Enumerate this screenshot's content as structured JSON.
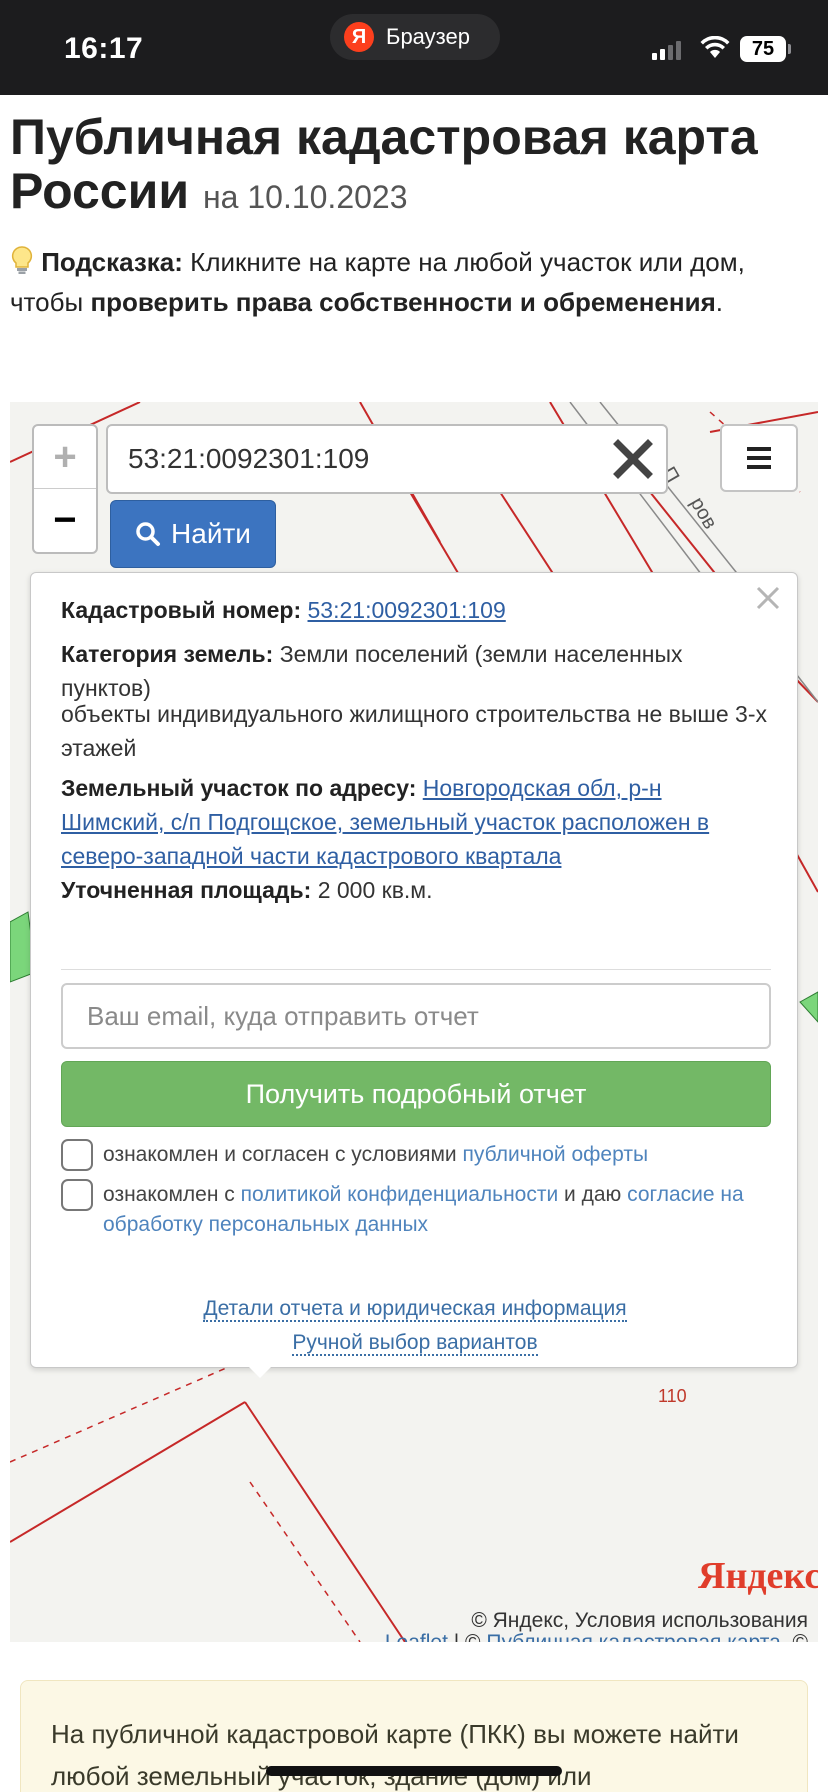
{
  "status_bar": {
    "time": "16:17",
    "browser": "Браузер",
    "browser_logo": "Я",
    "battery": "75"
  },
  "header": {
    "title": "Публичная кадастровая карта России",
    "date": "на 10.10.2023"
  },
  "hint": {
    "icon": "lightbulb-icon",
    "label": "Подсказка:",
    "text1": "Кликните на карте на любой участок или дом, чтобы",
    "bold": "проверить права собственности и обременения",
    "text2": "."
  },
  "map": {
    "zoom_in": "+",
    "zoom_out": "−",
    "search_value": "53:21:0092301:109",
    "find_label": "Найти",
    "street_fragment": "л. П",
    "street_fragment2": "ров",
    "parcel_label": "110",
    "brand": "Яндекс",
    "attribution_line1": "© Яндекс, Условия использования",
    "attribution_leaflet": "Leaflet",
    "attribution_sep": " | © ",
    "attribution_pkk": "Публичная кадастровая карта",
    "attribution_tail": ", ©"
  },
  "popup": {
    "cad_label": "Кадастровый номер:",
    "cad_value": "53:21:0092301:109",
    "cat_label": "Категория земель:",
    "cat_value": "Земли поселений (земли населенных пунктов)",
    "usage": "объекты индивидуального жилищного строительства не выше 3-х этажей",
    "addr_label": "Земельный участок по адресу:",
    "addr_value": "Новгородская обл, р-н Шимский, с/п Подгощское, земельный участок расположен в северо-западной части кадастрового квартала",
    "area_label": "Уточненная площадь:",
    "area_value": "2 000 кв.м.",
    "email_placeholder": "Ваш email, куда отправить отчет",
    "report_button": "Получить подробный отчет",
    "consent1_text": "ознакомлен и согласен с условиями",
    "consent1_link": "публичной оферты",
    "consent2_text": "ознакомлен с",
    "consent2_link1": "политикой конфиденциальности",
    "consent2_mid": "и даю",
    "consent2_link2": "согласие на обработку персональных данных",
    "details_link": "Детали отчета и юридическая информация",
    "manual_link": "Ручной выбор вариантов"
  },
  "info": {
    "text": "На публичной кадастровой карте (ПКК) вы можете найти любой земельный участок, здание (дом) или"
  },
  "colors": {
    "accent": "#3c74c0",
    "success": "#73b866",
    "boundary": "#c62828",
    "link": "#2f5fa3"
  }
}
